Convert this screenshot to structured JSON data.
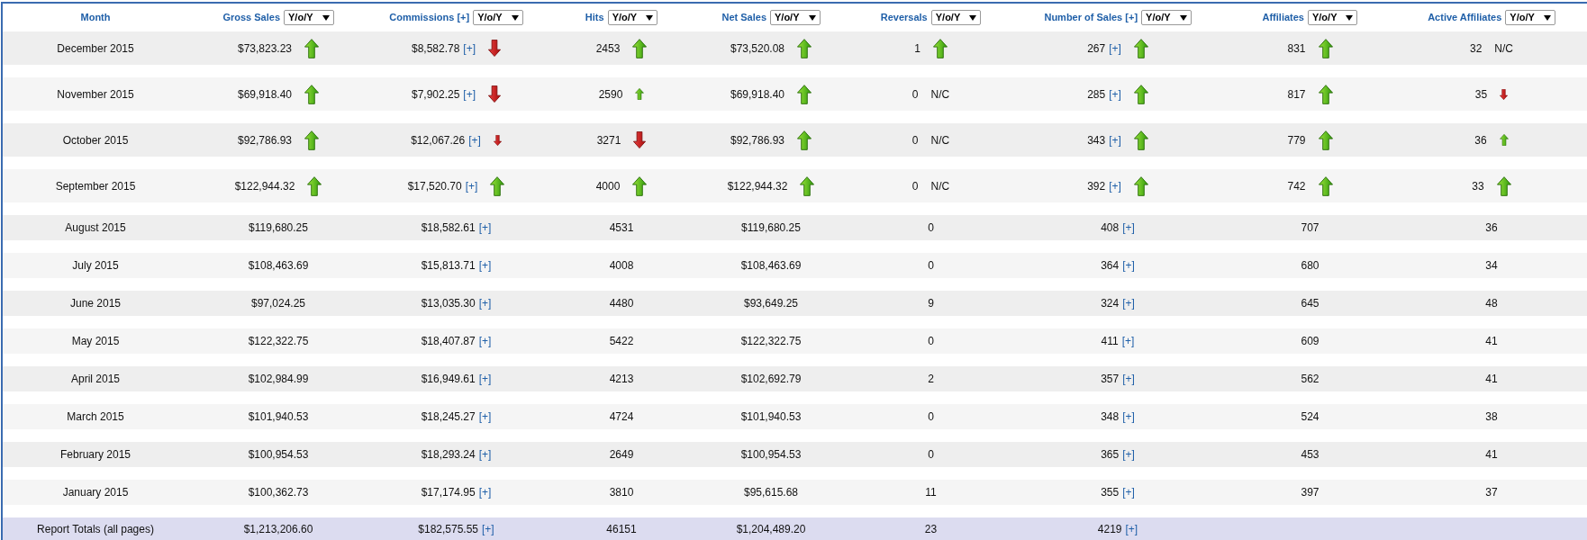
{
  "columns": [
    {
      "label": "Month"
    },
    {
      "label": "Gross Sales",
      "dropdown": "Y/o/Y"
    },
    {
      "label": "Commissions [+]",
      "dropdown": "Y/o/Y"
    },
    {
      "label": "Hits",
      "dropdown": "Y/o/Y"
    },
    {
      "label": "Net Sales",
      "dropdown": "Y/o/Y"
    },
    {
      "label": "Reversals",
      "dropdown": "Y/o/Y"
    },
    {
      "label": "Number of Sales [+]",
      "dropdown": "Y/o/Y"
    },
    {
      "label": "Affiliates",
      "dropdown": "Y/o/Y"
    },
    {
      "label": "Active Affiliates",
      "dropdown": "Y/o/Y"
    }
  ],
  "rows": [
    {
      "month": "December 2015",
      "cells": [
        {
          "value": "$73,823.23",
          "arrow": {
            "up": true,
            "small": false
          }
        },
        {
          "value": "$8,582.78",
          "link": "[+]",
          "arrow": {
            "up": false,
            "small": false
          }
        },
        {
          "value": "2453",
          "arrow": {
            "up": true,
            "small": false
          }
        },
        {
          "value": "$73,520.08",
          "arrow": {
            "up": true,
            "small": false
          }
        },
        {
          "value": "1",
          "arrow": {
            "up": true,
            "small": false
          }
        },
        {
          "value": "267",
          "link": "[+]",
          "arrow": {
            "up": true,
            "small": false
          }
        },
        {
          "value": "831",
          "arrow": {
            "up": true,
            "small": false
          }
        },
        {
          "value": "32",
          "note": "N/C"
        }
      ]
    },
    {
      "month": "November 2015",
      "cells": [
        {
          "value": "$69,918.40",
          "arrow": {
            "up": true,
            "small": false
          }
        },
        {
          "value": "$7,902.25",
          "link": "[+]",
          "arrow": {
            "up": false,
            "small": false
          }
        },
        {
          "value": "2590",
          "arrow": {
            "up": true,
            "small": true
          }
        },
        {
          "value": "$69,918.40",
          "arrow": {
            "up": true,
            "small": false
          }
        },
        {
          "value": "0",
          "note": "N/C"
        },
        {
          "value": "285",
          "link": "[+]",
          "arrow": {
            "up": true,
            "small": false
          }
        },
        {
          "value": "817",
          "arrow": {
            "up": true,
            "small": false
          }
        },
        {
          "value": "35",
          "arrow": {
            "up": false,
            "small": true
          }
        }
      ]
    },
    {
      "month": "October 2015",
      "cells": [
        {
          "value": "$92,786.93",
          "arrow": {
            "up": true,
            "small": false
          }
        },
        {
          "value": "$12,067.26",
          "link": "[+]",
          "arrow": {
            "up": false,
            "small": true
          }
        },
        {
          "value": "3271",
          "arrow": {
            "up": false,
            "small": false
          }
        },
        {
          "value": "$92,786.93",
          "arrow": {
            "up": true,
            "small": false
          }
        },
        {
          "value": "0",
          "note": "N/C"
        },
        {
          "value": "343",
          "link": "[+]",
          "arrow": {
            "up": true,
            "small": false
          }
        },
        {
          "value": "779",
          "arrow": {
            "up": true,
            "small": false
          }
        },
        {
          "value": "36",
          "arrow": {
            "up": true,
            "small": true
          }
        }
      ]
    },
    {
      "month": "September 2015",
      "cells": [
        {
          "value": "$122,944.32",
          "arrow": {
            "up": true,
            "small": false
          }
        },
        {
          "value": "$17,520.70",
          "link": "[+]",
          "arrow": {
            "up": true,
            "small": false
          }
        },
        {
          "value": "4000",
          "arrow": {
            "up": true,
            "small": false
          }
        },
        {
          "value": "$122,944.32",
          "arrow": {
            "up": true,
            "small": false
          }
        },
        {
          "value": "0",
          "note": "N/C"
        },
        {
          "value": "392",
          "link": "[+]",
          "arrow": {
            "up": true,
            "small": false
          }
        },
        {
          "value": "742",
          "arrow": {
            "up": true,
            "small": false
          }
        },
        {
          "value": "33",
          "arrow": {
            "up": true,
            "small": false
          }
        }
      ]
    },
    {
      "month": "August 2015",
      "cells": [
        {
          "value": "$119,680.25"
        },
        {
          "value": "$18,582.61",
          "link": "[+]"
        },
        {
          "value": "4531"
        },
        {
          "value": "$119,680.25"
        },
        {
          "value": "0"
        },
        {
          "value": "408",
          "link": "[+]"
        },
        {
          "value": "707"
        },
        {
          "value": "36"
        }
      ]
    },
    {
      "month": "July 2015",
      "cells": [
        {
          "value": "$108,463.69"
        },
        {
          "value": "$15,813.71",
          "link": "[+]"
        },
        {
          "value": "4008"
        },
        {
          "value": "$108,463.69"
        },
        {
          "value": "0"
        },
        {
          "value": "364",
          "link": "[+]"
        },
        {
          "value": "680"
        },
        {
          "value": "34"
        }
      ]
    },
    {
      "month": "June 2015",
      "cells": [
        {
          "value": "$97,024.25"
        },
        {
          "value": "$13,035.30",
          "link": "[+]"
        },
        {
          "value": "4480"
        },
        {
          "value": "$93,649.25"
        },
        {
          "value": "9"
        },
        {
          "value": "324",
          "link": "[+]"
        },
        {
          "value": "645"
        },
        {
          "value": "48"
        }
      ]
    },
    {
      "month": "May 2015",
      "cells": [
        {
          "value": "$122,322.75"
        },
        {
          "value": "$18,407.87",
          "link": "[+]"
        },
        {
          "value": "5422"
        },
        {
          "value": "$122,322.75"
        },
        {
          "value": "0"
        },
        {
          "value": "411",
          "link": "[+]"
        },
        {
          "value": "609"
        },
        {
          "value": "41"
        }
      ]
    },
    {
      "month": "April 2015",
      "cells": [
        {
          "value": "$102,984.99"
        },
        {
          "value": "$16,949.61",
          "link": "[+]"
        },
        {
          "value": "4213"
        },
        {
          "value": "$102,692.79"
        },
        {
          "value": "2"
        },
        {
          "value": "357",
          "link": "[+]"
        },
        {
          "value": "562"
        },
        {
          "value": "41"
        }
      ]
    },
    {
      "month": "March 2015",
      "cells": [
        {
          "value": "$101,940.53"
        },
        {
          "value": "$18,245.27",
          "link": "[+]"
        },
        {
          "value": "4724"
        },
        {
          "value": "$101,940.53"
        },
        {
          "value": "0"
        },
        {
          "value": "348",
          "link": "[+]"
        },
        {
          "value": "524"
        },
        {
          "value": "38"
        }
      ]
    },
    {
      "month": "February 2015",
      "cells": [
        {
          "value": "$100,954.53"
        },
        {
          "value": "$18,293.24",
          "link": "[+]"
        },
        {
          "value": "2649"
        },
        {
          "value": "$100,954.53"
        },
        {
          "value": "0"
        },
        {
          "value": "365",
          "link": "[+]"
        },
        {
          "value": "453"
        },
        {
          "value": "41"
        }
      ]
    },
    {
      "month": "January 2015",
      "cells": [
        {
          "value": "$100,362.73"
        },
        {
          "value": "$17,174.95",
          "link": "[+]"
        },
        {
          "value": "3810"
        },
        {
          "value": "$95,615.68"
        },
        {
          "value": "11"
        },
        {
          "value": "355",
          "link": "[+]"
        },
        {
          "value": "397"
        },
        {
          "value": "37"
        }
      ]
    }
  ],
  "totals": {
    "label": "Report Totals (all pages)",
    "cells": [
      {
        "value": "$1,213,206.60"
      },
      {
        "value": "$182,575.55",
        "link": "[+]"
      },
      {
        "value": "46151"
      },
      {
        "value": "$1,204,489.20"
      },
      {
        "value": "23"
      },
      {
        "value": "4219",
        "link": "[+]"
      }
    ]
  }
}
